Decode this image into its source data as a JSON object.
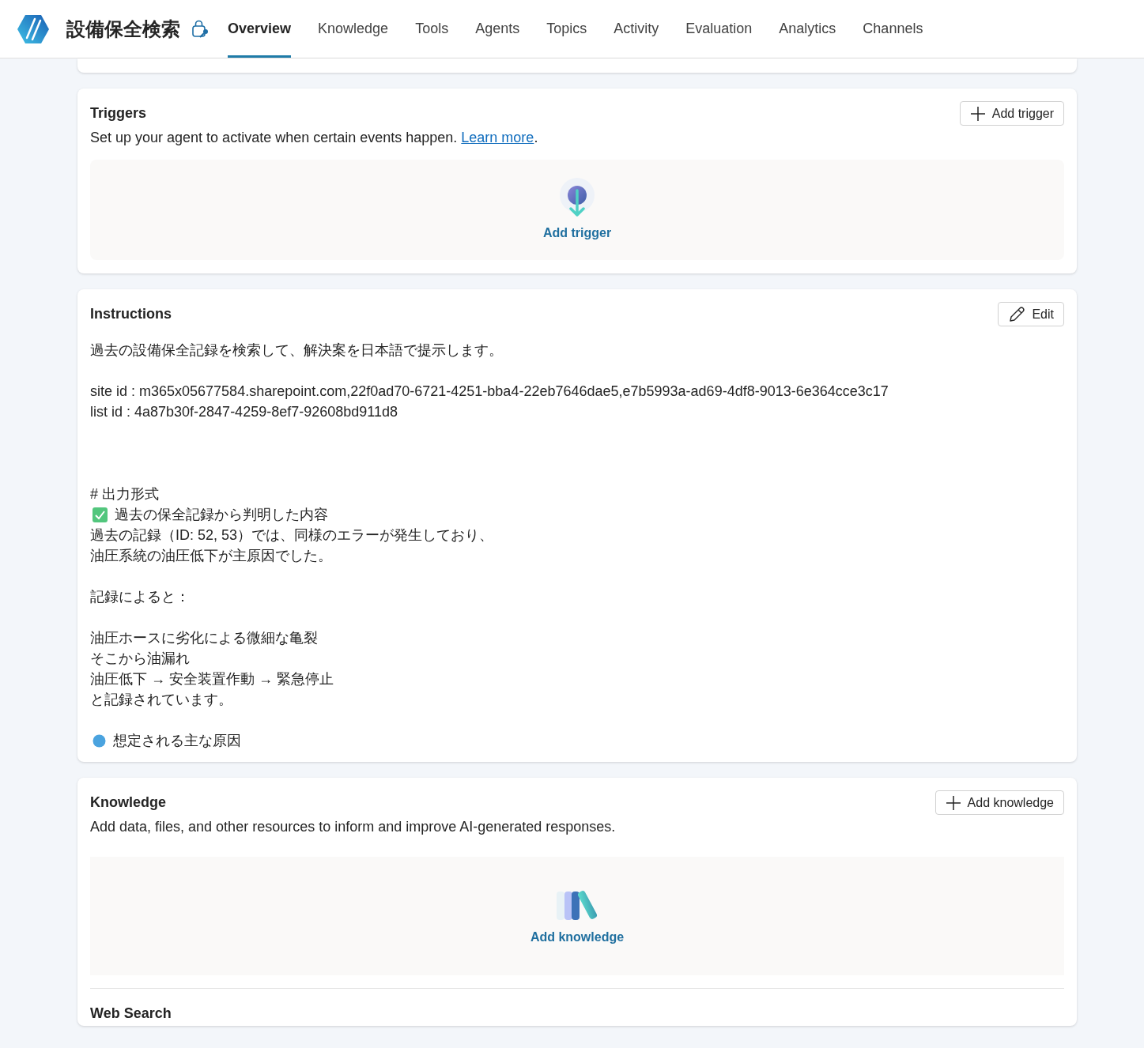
{
  "app": {
    "title": "設備保全検索"
  },
  "tabs": [
    {
      "label": "Overview",
      "selected": true
    },
    {
      "label": "Knowledge",
      "selected": false
    },
    {
      "label": "Tools",
      "selected": false
    },
    {
      "label": "Agents",
      "selected": false
    },
    {
      "label": "Topics",
      "selected": false
    },
    {
      "label": "Activity",
      "selected": false
    },
    {
      "label": "Evaluation",
      "selected": false
    },
    {
      "label": "Analytics",
      "selected": false
    },
    {
      "label": "Channels",
      "selected": false
    }
  ],
  "triggers": {
    "title": "Triggers",
    "button": "Add trigger",
    "description": "Set up your agent to activate when certain events happen.",
    "link": "Learn more",
    "after_link": ".",
    "empty_action": "Add trigger"
  },
  "instructions": {
    "title": "Instructions",
    "button": "Edit",
    "lines": [
      {
        "kind": "text",
        "text": "過去の設備保全記録を検索して、解決案を日本語で提示します。"
      },
      {
        "kind": "blank"
      },
      {
        "kind": "text",
        "text": "site id : m365x05677584.sharepoint.com,22f0ad70-6721-4251-bba4-22eb7646dae5,e7b5993a-ad69-4df8-9013-6e364cce3c17"
      },
      {
        "kind": "text",
        "text": "list id : 4a87b30f-2847-4259-8ef7-92608bd911d8"
      },
      {
        "kind": "blank"
      },
      {
        "kind": "blank"
      },
      {
        "kind": "blank"
      },
      {
        "kind": "text",
        "text": "# 出力形式"
      },
      {
        "kind": "check",
        "text": "過去の保全記録から判明した内容"
      },
      {
        "kind": "text",
        "text": "過去の記録（ID: 52, 53）では、同様のエラーが発生しており、"
      },
      {
        "kind": "text",
        "text": "油圧系統の油圧低下が主原因でした。"
      },
      {
        "kind": "blank"
      },
      {
        "kind": "text",
        "text": "記録によると："
      },
      {
        "kind": "blank"
      },
      {
        "kind": "text",
        "text": "油圧ホースに劣化による微細な亀裂"
      },
      {
        "kind": "text",
        "text": "そこから油漏れ"
      },
      {
        "kind": "text",
        "text": "油圧低下 → 安全装置作動 → 緊急停止"
      },
      {
        "kind": "text",
        "text": "と記録されています。"
      },
      {
        "kind": "blank"
      },
      {
        "kind": "dot",
        "text": "想定される主な原因"
      }
    ]
  },
  "knowledge": {
    "title": "Knowledge",
    "button": "Add knowledge",
    "description": "Add data, files, and other resources to inform and improve AI-generated responses.",
    "empty_action": "Add knowledge",
    "section_title": "Web Search"
  }
}
